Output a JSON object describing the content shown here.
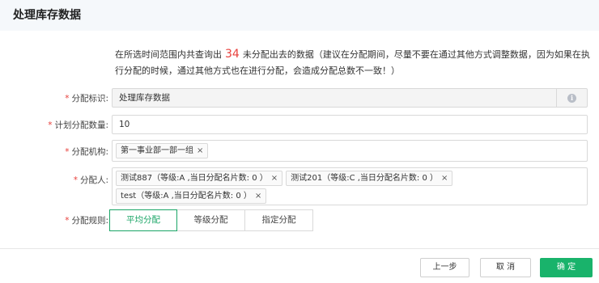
{
  "header": {
    "title": "处理库存数据"
  },
  "notice": {
    "prefix": "在所选时间范围内共查询出",
    "count": "34",
    "suffix": "未分配出去的数据（建议在分配期间，尽量不要在通过其他方式调整数据，因为如果在执行分配的时候，通过其他方式也在进行分配，会造成分配总数不一致！）"
  },
  "form": {
    "required_mark": "*",
    "id_label": "分配标识:",
    "id_value": "处理库存数据",
    "id_info_icon": "info-icon",
    "count_label": "计划分配数量:",
    "count_value": "10",
    "org_label": "分配机构:",
    "org_tags": [
      {
        "label": "第一事业部一部一组",
        "remove": "×"
      }
    ],
    "person_label": "分配人:",
    "person_tags": [
      {
        "label": "测试887（等级:A ,当日分配名片数: 0 ）",
        "remove": "×"
      },
      {
        "label": "测试201（等级:C ,当日分配名片数: 0 ）",
        "remove": "×"
      },
      {
        "label": "test（等级:A ,当日分配名片数: 0 ）",
        "remove": "×"
      }
    ],
    "rule_label": "分配规则:",
    "rule_options": [
      "平均分配",
      "等级分配",
      "指定分配"
    ],
    "rule_selected": "平均分配"
  },
  "footer": {
    "prev_label": "上一步",
    "cancel_label": "取 消",
    "confirm_label": "确 定"
  },
  "colors": {
    "accent": "#19b36b",
    "required": "#e8403c",
    "header_bg": "#f5f8fb"
  }
}
